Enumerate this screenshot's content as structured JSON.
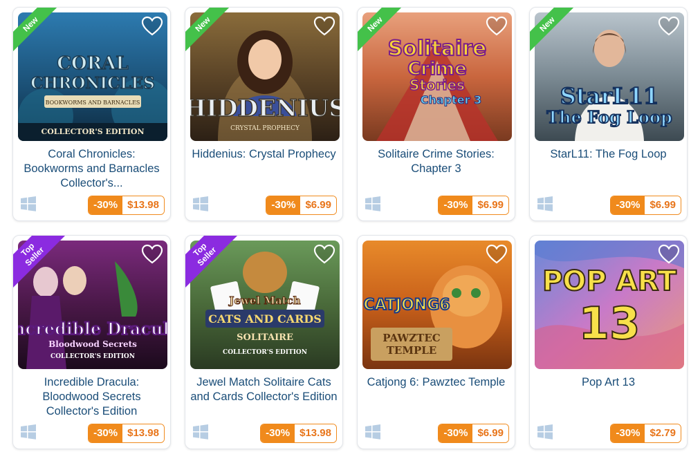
{
  "cards": [
    {
      "title": "Coral Chronicles: Bookworms and Barnacles Collector's...",
      "ribbon": "New",
      "ribbon_type": "new",
      "discount": "-30%",
      "price": "$13.98",
      "art_text": [
        "CORAL",
        "CHRONICLES",
        "BOOKWORMS AND BARNACLES",
        "COLLECTOR'S EDITION"
      ],
      "platform_icon": "windows-icon"
    },
    {
      "title": "Hiddenius: Crystal Prophecy",
      "ribbon": "New",
      "ribbon_type": "new",
      "discount": "-30%",
      "price": "$6.99",
      "art_text": [
        "HIDDENIUS",
        "CRYSTAL PROPHECY"
      ],
      "platform_icon": "windows-icon"
    },
    {
      "title": "Solitaire Crime Stories: Chapter 3",
      "ribbon": "New",
      "ribbon_type": "new",
      "discount": "-30%",
      "price": "$6.99",
      "art_text": [
        "Solitaire",
        "Crime",
        "Stories",
        "Chapter 3"
      ],
      "platform_icon": "windows-icon"
    },
    {
      "title": "StarL11: The Fog Loop",
      "ribbon": "New",
      "ribbon_type": "new",
      "discount": "-30%",
      "price": "$6.99",
      "art_text": [
        "StarL11",
        "The Fog Loop"
      ],
      "platform_icon": "windows-icon"
    },
    {
      "title": "Incredible Dracula: Bloodwood Secrets Collector's Edition",
      "ribbon": "Top Seller",
      "ribbon_type": "top",
      "discount": "-30%",
      "price": "$13.98",
      "art_text": [
        "Incredible Dracula",
        "Bloodwood Secrets",
        "COLLECTOR'S EDITION"
      ],
      "platform_icon": "windows-icon"
    },
    {
      "title": "Jewel Match Solitaire Cats and Cards Collector's Edition",
      "ribbon": "Top Seller",
      "ribbon_type": "top",
      "discount": "-30%",
      "price": "$13.98",
      "art_text": [
        "Jewel Match",
        "CATS AND CARDS",
        "SOLITAIRE",
        "COLLECTOR'S EDITION"
      ],
      "platform_icon": "windows-icon"
    },
    {
      "title": "Catjong 6: Pawztec Temple",
      "ribbon": "",
      "ribbon_type": "none",
      "discount": "-30%",
      "price": "$6.99",
      "art_text": [
        "CATJONG6",
        "PAWZTEC",
        "TEMPLE"
      ],
      "platform_icon": "windows-icon"
    },
    {
      "title": "Pop Art 13",
      "ribbon": "",
      "ribbon_type": "none",
      "discount": "-30%",
      "price": "$2.79",
      "art_text": [
        "POP ART",
        "13"
      ],
      "platform_icon": "windows-icon"
    }
  ],
  "colors": {
    "title": "#1a4d78",
    "discount_bg": "#f08a1c",
    "new_ribbon": "#44c14a",
    "top_ribbon": "#8b2be0"
  }
}
